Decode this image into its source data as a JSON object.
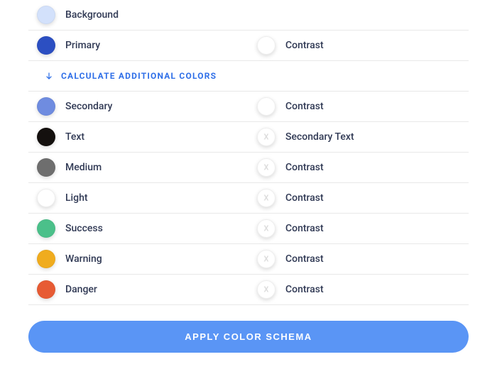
{
  "colors": {
    "background": {
      "label": "Background",
      "color": "#d3e1fb"
    },
    "primary": {
      "label": "Primary",
      "color": "#2c4fc2",
      "contrast_label": "Contrast",
      "contrast_color": "#ffffff",
      "has_x": false
    },
    "secondary": {
      "label": "Secondary",
      "color": "#6f8ce0",
      "contrast_label": "Contrast",
      "contrast_color": "#ffffff",
      "has_x": false
    },
    "text": {
      "label": "Text",
      "color": "#14100e",
      "contrast_label": "Secondary Text",
      "contrast_color": "#ffffff",
      "has_x": true
    },
    "medium": {
      "label": "Medium",
      "color": "#6e6e6e",
      "contrast_label": "Contrast",
      "contrast_color": "#ffffff",
      "has_x": true
    },
    "light": {
      "label": "Light",
      "color": "#ffffff",
      "contrast_label": "Contrast",
      "contrast_color": "#ffffff",
      "has_x": true
    },
    "success": {
      "label": "Success",
      "color": "#4bc08a",
      "contrast_label": "Contrast",
      "contrast_color": "#ffffff",
      "has_x": true
    },
    "warning": {
      "label": "Warning",
      "color": "#f0ac1e",
      "contrast_label": "Contrast",
      "contrast_color": "#ffffff",
      "has_x": true
    },
    "danger": {
      "label": "Danger",
      "color": "#e75b34",
      "contrast_label": "Contrast",
      "contrast_color": "#ffffff",
      "has_x": true
    }
  },
  "calculate_label": "CALCULATE ADDITIONAL COLORS",
  "apply_label": "APPLY COLOR SCHEMA"
}
